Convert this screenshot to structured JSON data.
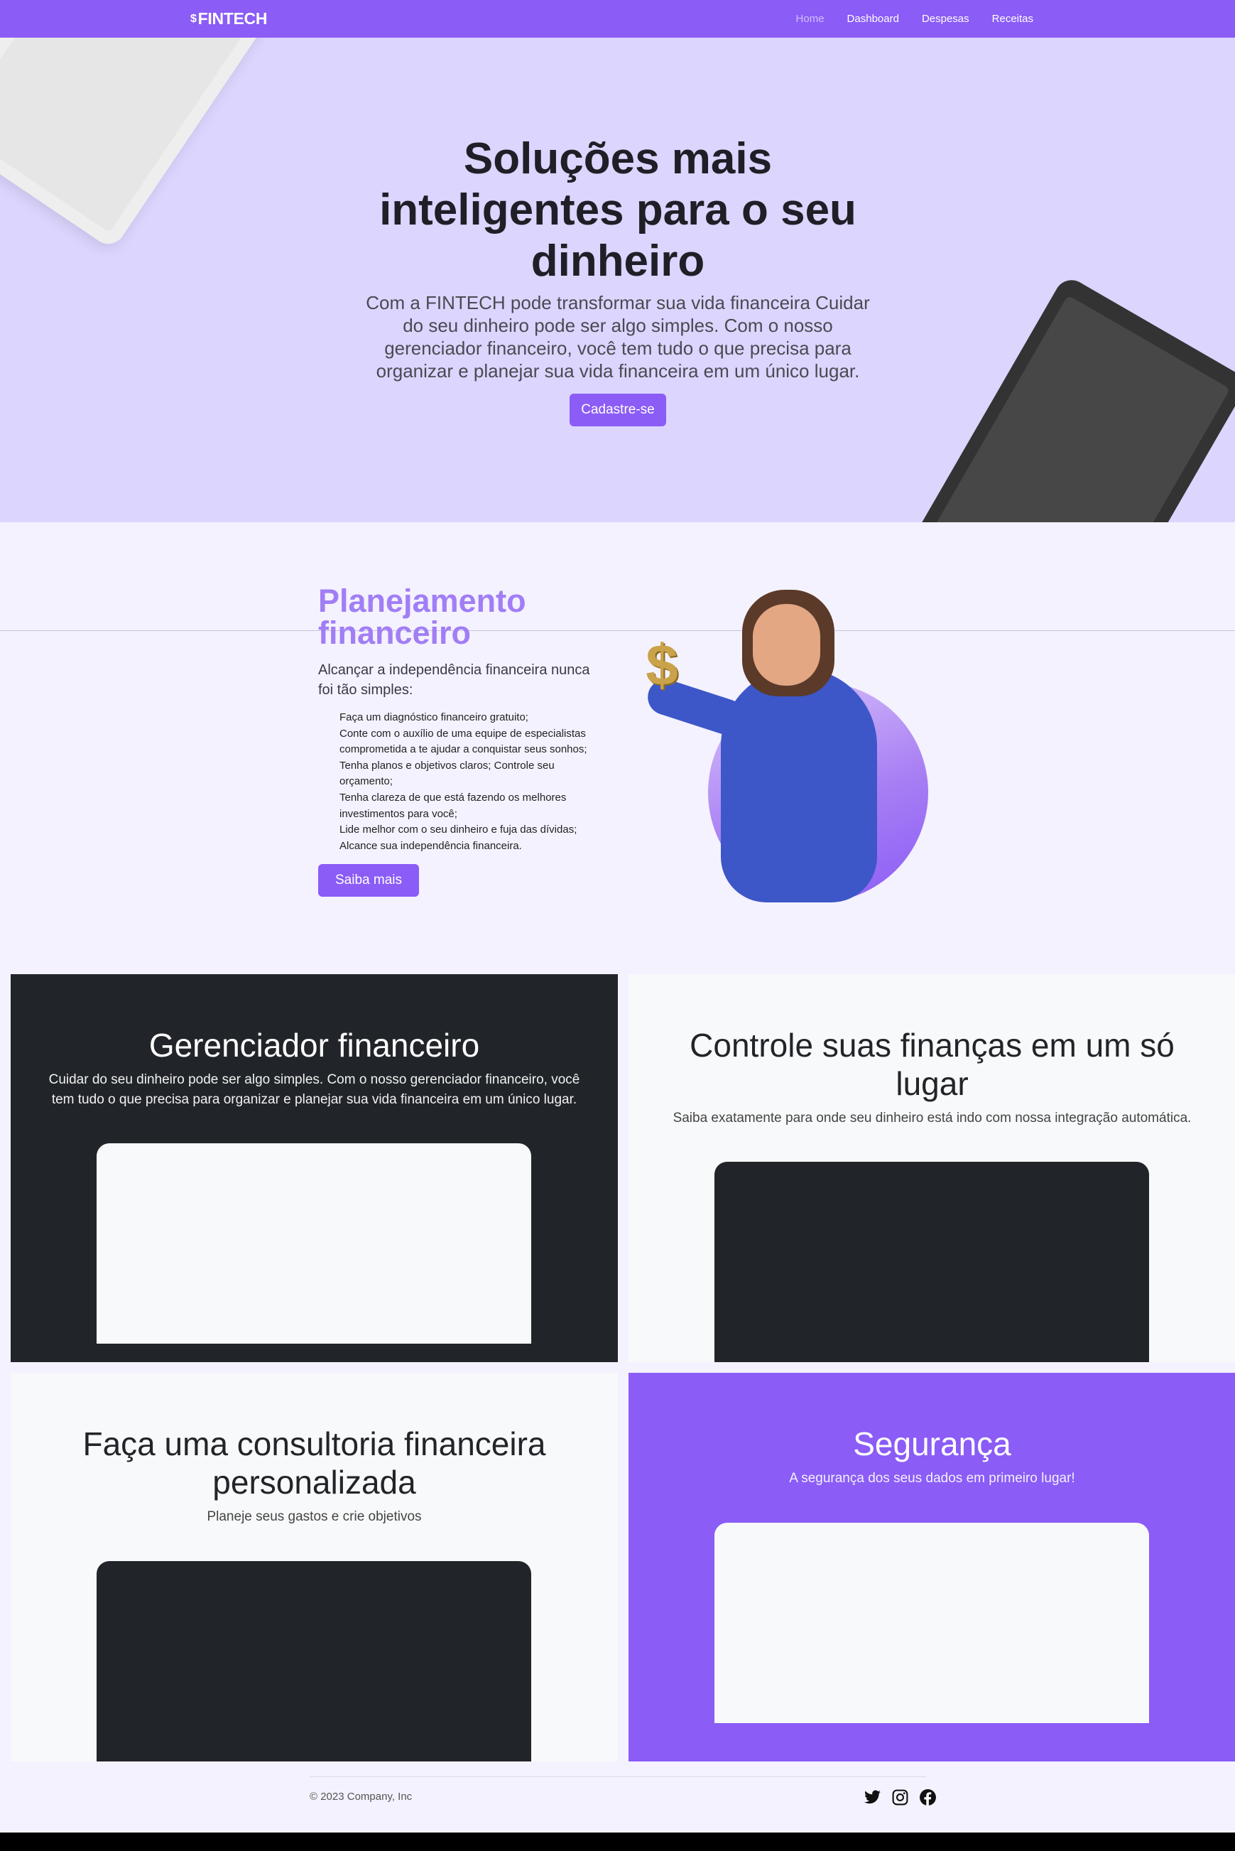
{
  "navbar": {
    "brand_icon": "$",
    "brand": "FINTECH",
    "links": [
      {
        "label": "Home",
        "active": true
      },
      {
        "label": "Dashboard",
        "active": false
      },
      {
        "label": "Despesas",
        "active": false
      },
      {
        "label": "Receitas",
        "active": false
      }
    ]
  },
  "hero": {
    "title": "Soluções mais inteligentes para o seu dinheiro",
    "text": "Com a FINTECH pode transformar sua vida financeira Cuidar do seu dinheiro pode ser algo simples. Com o nosso gerenciador financeiro, você tem tudo o que precisa para organizar e planejar sua vida financeira em um único lugar.",
    "button": "Cadastre-se"
  },
  "planning": {
    "title": "Planejamento financeiro",
    "lead": "Alcançar a independência financeira nunca foi tão simples:",
    "items": [
      "Faça um diagnóstico financeiro gratuito;",
      "Conte com o auxílio de uma equipe de especialistas comprometida a te ajudar a conquistar seus sonhos;",
      "Tenha planos e objetivos claros; Controle seu orçamento;",
      "Tenha clareza de que está fazendo os melhores investimentos para você;",
      "Lide melhor com o seu dinheiro e fuja das dívidas;",
      "Alcance sua independência financeira."
    ],
    "button": "Saiba mais",
    "image_symbol": "$"
  },
  "features": [
    {
      "title": "Gerenciador financeiro",
      "text": "Cuidar do seu dinheiro pode ser algo simples. Com o nosso gerenciador financeiro, você tem tudo o que precisa para organizar e planejar sua vida financeira em um único lugar."
    },
    {
      "title": "Controle suas finanças em um só lugar",
      "text": "Saiba exatamente para onde seu dinheiro está indo com nossa integração automática."
    },
    {
      "title": "Faça uma consultoria financeira personalizada",
      "text": "Planeje seus gastos e crie objetivos"
    },
    {
      "title": "Segurança",
      "text": "A segurança dos seus dados em primeiro lugar!"
    }
  ],
  "footer": {
    "copyright": "© 2023 Company, Inc",
    "social": [
      "twitter-icon",
      "instagram-icon",
      "facebook-icon"
    ]
  },
  "colors": {
    "brand": "#8b5cf6",
    "hero_bg": "#dcd5fe",
    "dark": "#212529",
    "light": "#f8f9fa",
    "planning_title": "#a17ef5"
  }
}
